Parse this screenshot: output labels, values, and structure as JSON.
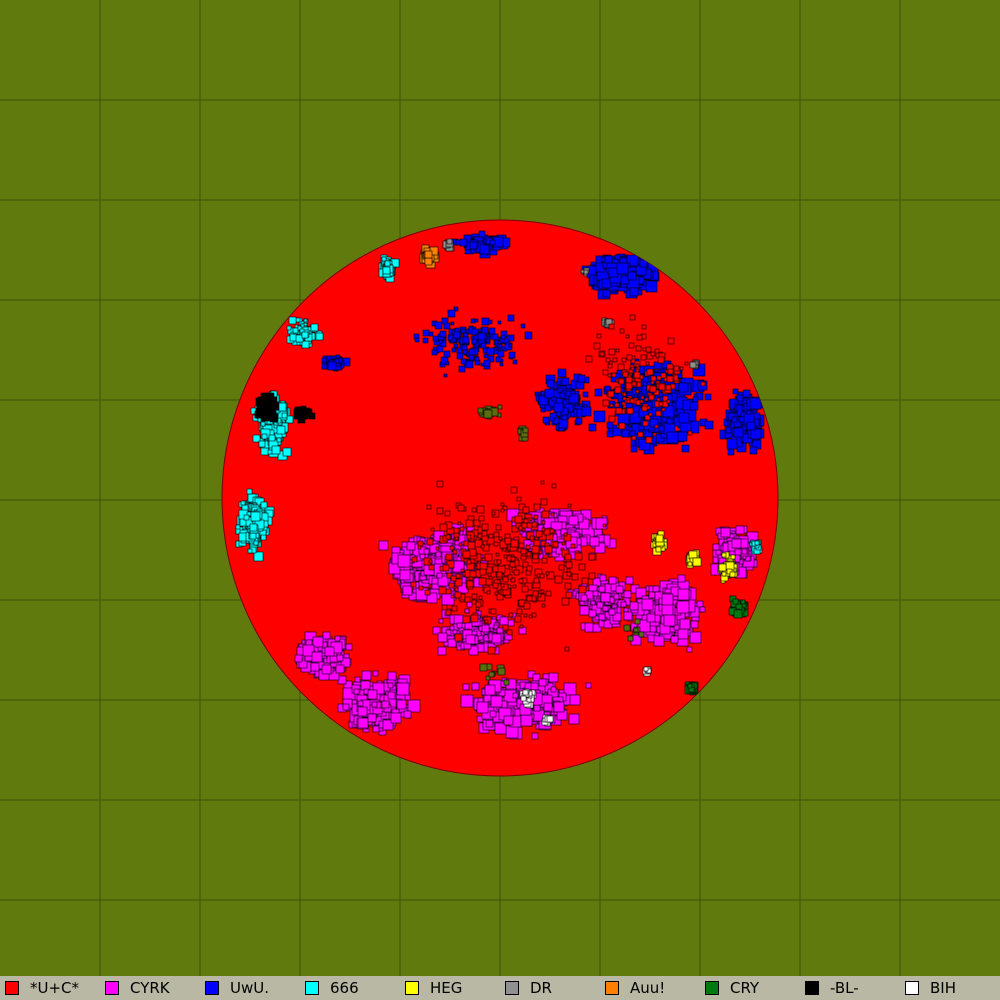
{
  "map": {
    "background_color": "#617a0d",
    "grid_color": "#3b5408",
    "grid_lines": 9,
    "planet_base_color": "#ff0000"
  },
  "legend": {
    "items": [
      {
        "label": "*U+C*",
        "color": "#ff0000"
      },
      {
        "label": "CYRK",
        "color": "#ff00ff"
      },
      {
        "label": "UwU.",
        "color": "#0000ff"
      },
      {
        "label": "666",
        "color": "#00ffff"
      },
      {
        "label": "HEG",
        "color": "#ffff00"
      },
      {
        "label": "DR",
        "color": "#909090"
      },
      {
        "label": "Auu!",
        "color": "#ff8000"
      },
      {
        "label": "CRY",
        "color": "#007a10"
      },
      {
        "label": "-BL-",
        "color": "#000000"
      },
      {
        "label": "BIH",
        "color": "#ffffff"
      }
    ]
  }
}
